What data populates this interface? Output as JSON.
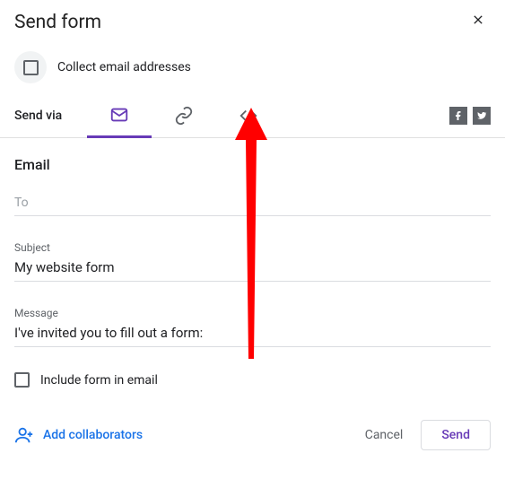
{
  "header": {
    "title": "Send form"
  },
  "collect": {
    "label": "Collect email addresses"
  },
  "send_via": {
    "label": "Send via"
  },
  "email": {
    "section_title": "Email",
    "to_placeholder": "To",
    "subject_label": "Subject",
    "subject_value": "My website form",
    "message_label": "Message",
    "message_value": "I've invited you to fill out a form:",
    "include_label": "Include form in email"
  },
  "footer": {
    "add_collaborators": "Add collaborators",
    "cancel": "Cancel",
    "send": "Send"
  }
}
